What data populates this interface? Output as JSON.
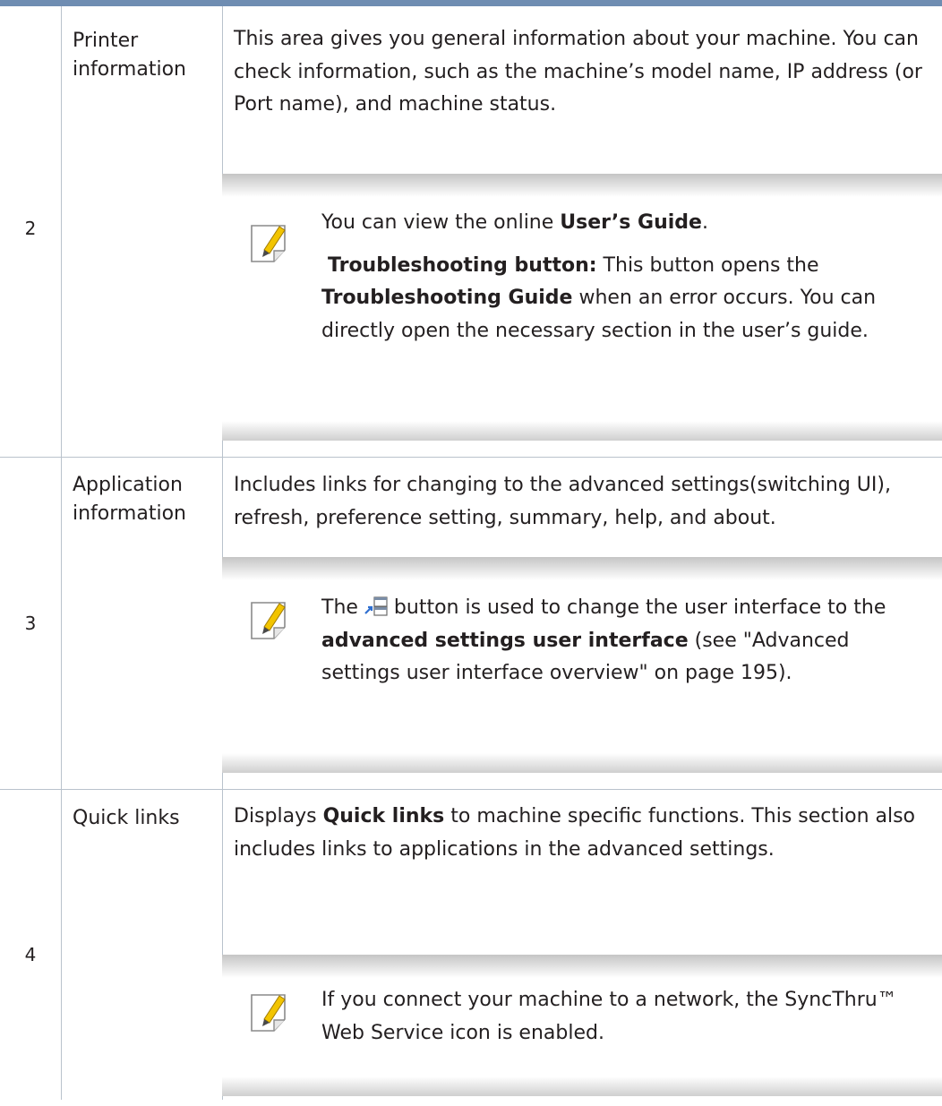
{
  "rows": [
    {
      "number": "2",
      "label_lines": [
        "Printer",
        "information"
      ],
      "description": "This area gives you general information about your machine. You can check information, such as the machine’s model name, IP address (or Port name), and machine status.",
      "note": {
        "icon": "note-pencil-icon",
        "p1_before": "You can view the online ",
        "p1_bold": "User’s Guide",
        "p1_after": ".",
        "p2_bold1": "Troubleshooting button:",
        "p2_mid": " This button opens the ",
        "p2_bold2": "Troubleshooting Guide",
        "p2_after": " when an error occurs. You can directly open the necessary section in the user’s guide."
      }
    },
    {
      "number": "3",
      "label_lines": [
        "Application",
        "information"
      ],
      "description": "Includes links for changing to the advanced settings(switching UI), refresh, preference setting, summary, help, and about.",
      "note": {
        "icon": "note-pencil-icon",
        "p1_before": "The",
        "inline_icon": "switch-ui-icon",
        "p1_mid": "button is used to change the user interface to the ",
        "p1_bold": "advanced settings user interface",
        "p1_after": " (see \"Advanced settings user interface overview\" on page 195)."
      }
    },
    {
      "number": "4",
      "label_lines": [
        "Quick links"
      ],
      "description_before": "Displays ",
      "description_bold": "Quick links",
      "description_after": " to machine specific functions. This section also includes links to applications in the advanced settings.",
      "note": {
        "icon": "note-pencil-icon",
        "p1": "If you connect your machine to a network, the SyncThru™ Web Service icon is enabled."
      }
    }
  ],
  "colors": {
    "top_rule": "#6f8db2",
    "grid_lines": "#b9c2cc",
    "text": "#231f20",
    "note_shade": "#c5c5c5",
    "pencil": "#f2c400"
  }
}
